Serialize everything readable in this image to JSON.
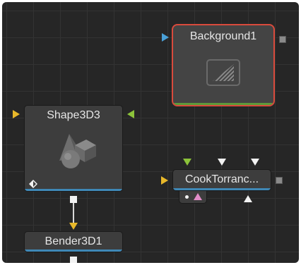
{
  "nodes": {
    "background": {
      "label": "Background1"
    },
    "shape3d": {
      "label": "Shape3D3"
    },
    "cooktorrance": {
      "label": "CookTorranc..."
    },
    "bender": {
      "label": "Bender3D1"
    }
  },
  "colors": {
    "canvas": "#262626",
    "grid": "#333333",
    "node_fill": "#3d3d3d",
    "selected_border": "#d94a3c",
    "input_yellow": "#e8b82a",
    "input_blue": "#4aa0d8",
    "input_green": "#8cc33a",
    "effect_pink": "#e28cc8",
    "status_blue": "#3f88b6",
    "status_green": "#5e9a3a"
  },
  "icons": {
    "background": "gradient-image-icon",
    "shape3d": "3d-shapes-icon",
    "shape3d_badge": "diamond-marker-icon"
  }
}
